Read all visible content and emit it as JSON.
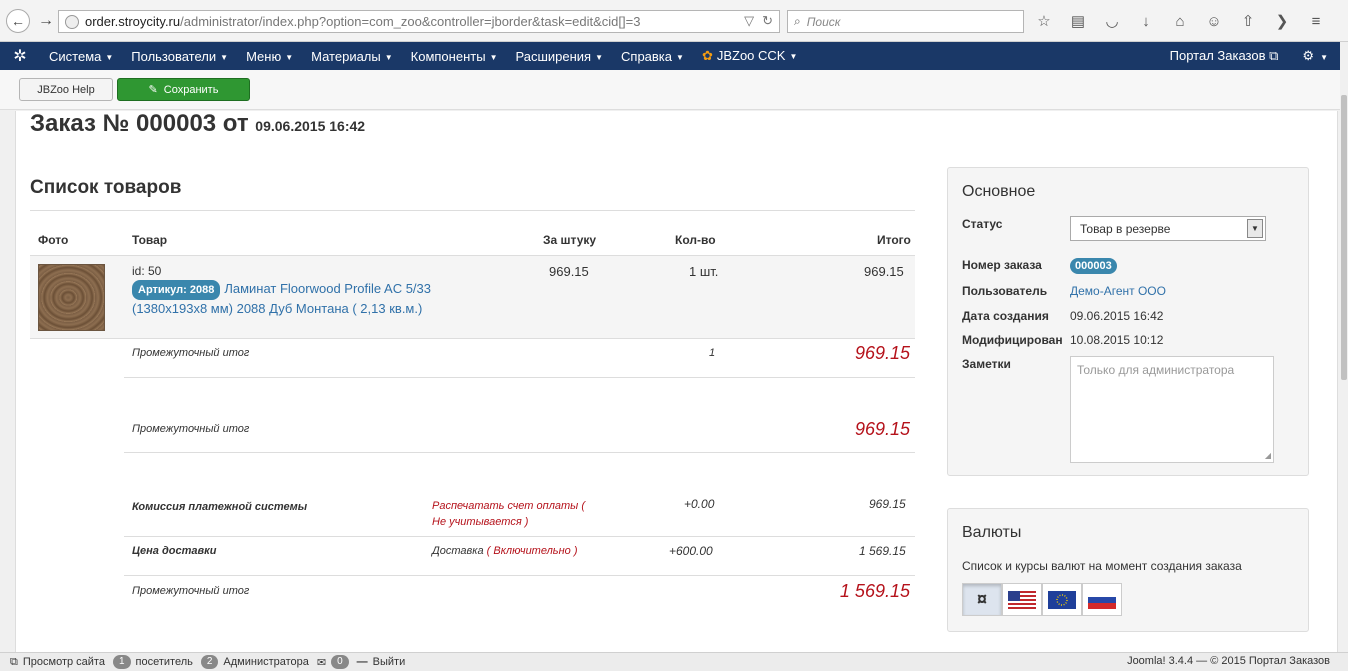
{
  "browser": {
    "url_host": "order.stroycity.ru",
    "url_path": "/administrator/index.php?option=com_zoo&controller=jborder&task=edit&cid[]=3",
    "search_placeholder": "Поиск"
  },
  "admin_nav": {
    "items": [
      "Система",
      "Пользователи",
      "Меню",
      "Материалы",
      "Компоненты",
      "Расширения",
      "Справка",
      "JBZoo CCK"
    ],
    "site_link": "Портал Заказов"
  },
  "toolbar": {
    "help_label": "JBZoo Help",
    "save_label": "Сохранить"
  },
  "order": {
    "title": "Заказ № 000003 от",
    "date": "09.06.2015 16:42"
  },
  "products": {
    "section_title": "Список товаров",
    "headers": {
      "photo": "Фото",
      "product": "Товар",
      "unit_price": "За штуку",
      "qty": "Кол-во",
      "total": "Итого"
    },
    "item": {
      "id_text": "id: 50",
      "sku": "Артикул: 2088",
      "name_line1": "Ламинат Floorwood Profile AC 5/33",
      "name_line2": "(1380x193x8 мм) 2088 Дуб Монтана ( 2,13 кв.м.)",
      "price": "969.15",
      "qty": "1 шт.",
      "total": "969.15"
    },
    "subtotal1": {
      "label": "Промежуточный итог",
      "qty": "1",
      "amount": "969.15"
    },
    "subtotal2": {
      "label": "Промежуточный итог",
      "amount": "969.15"
    },
    "commission": {
      "label": "Комиссия платежной системы",
      "desc_line1": "Распечатать счет оплаты",
      "desc_line1_suffix": "(",
      "desc_line2": "Не учитывается )",
      "delta": "+0.00",
      "sum": "969.15"
    },
    "delivery": {
      "label": "Цена доставки",
      "desc": "Доставка",
      "desc_status": "( Включительно )",
      "delta": "+600.00",
      "sum": "1 569.15"
    },
    "subtotal3": {
      "label": "Промежуточный итог",
      "amount": "1 569.15"
    }
  },
  "main_panel": {
    "title": "Основное",
    "status_label": "Статус",
    "status_value": "Товар в резерве",
    "order_number_label": "Номер заказа",
    "order_number": "000003",
    "user_label": "Пользователь",
    "user_value": "Демо-Агент ООО",
    "created_label": "Дата создания",
    "created_value": "09.06.2015 16:42",
    "modified_label": "Модифицирован",
    "modified_value": "10.08.2015 10:12",
    "notes_label": "Заметки",
    "notes_placeholder": "Только для администратора"
  },
  "currency_panel": {
    "title": "Валюты",
    "description": "Список и курсы валют на момент создания заказа",
    "default_symbol": "¤"
  },
  "statusbar": {
    "view_site": "Просмотр сайта",
    "visitors_count": "1",
    "visitors_label": "посетитель",
    "admins_count": "2",
    "admins_label": "Администратора",
    "messages_count": "0",
    "logout": "Выйти",
    "footer": "Joomla! 3.4.4 — © 2015 Портал Заказов"
  },
  "colors": {
    "nav_bg": "#1a3867",
    "save_green": "#2f9732",
    "badge_blue": "#3a87ad",
    "total_red": "#b5121b",
    "link_blue": "#3071a9"
  }
}
